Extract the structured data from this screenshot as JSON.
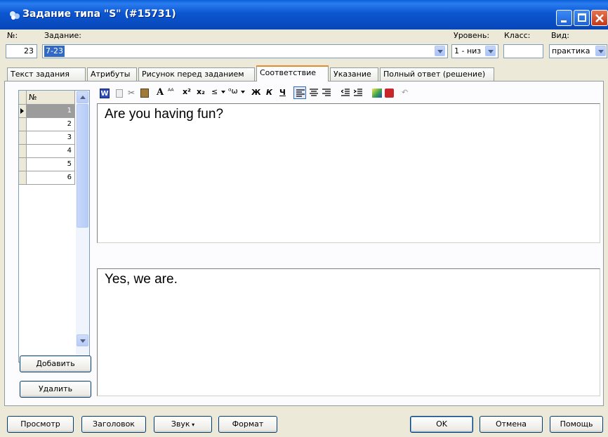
{
  "window": {
    "title": "Задание типа \"S\" (#15731)"
  },
  "header": {
    "num_label": "№:",
    "num_value": "23",
    "task_label": "Задание:",
    "task_value": "7-23",
    "level_label": "Уровень:",
    "level_value": "1 - низ",
    "class_label": "Класс:",
    "class_value": "",
    "kind_label": "Вид:",
    "kind_value": "практика"
  },
  "tabs": [
    {
      "label": "Текст задания"
    },
    {
      "label": "Атрибуты"
    },
    {
      "label": "Рисунок перед заданием"
    },
    {
      "label": "Соответствие"
    },
    {
      "label": "Указание"
    },
    {
      "label": "Полный ответ (решение)"
    }
  ],
  "grid": {
    "header": "№",
    "rows": [
      "1",
      "2",
      "3",
      "4",
      "5",
      "6"
    ],
    "selected_index": 0
  },
  "toolbar": {
    "font_glyph": "A",
    "superscript": "x²",
    "subscript": "x₂",
    "bold": "Ж",
    "italic": "К",
    "underline": "Ч"
  },
  "editor_question": "Are you having fun?",
  "editor_answer": "Yes, we are.",
  "side_buttons": {
    "add": "Добавить",
    "delete": "Удалить"
  },
  "footer": {
    "preview": "Просмотр",
    "heading": "Заголовок",
    "sound": "Звук",
    "format": "Формат",
    "ok": "OK",
    "cancel": "Отмена",
    "help": "Помощь"
  },
  "colors": {
    "titlebar": "#0b56d0",
    "tab_accent": "#e68b2c",
    "selection": "#316ac5"
  }
}
